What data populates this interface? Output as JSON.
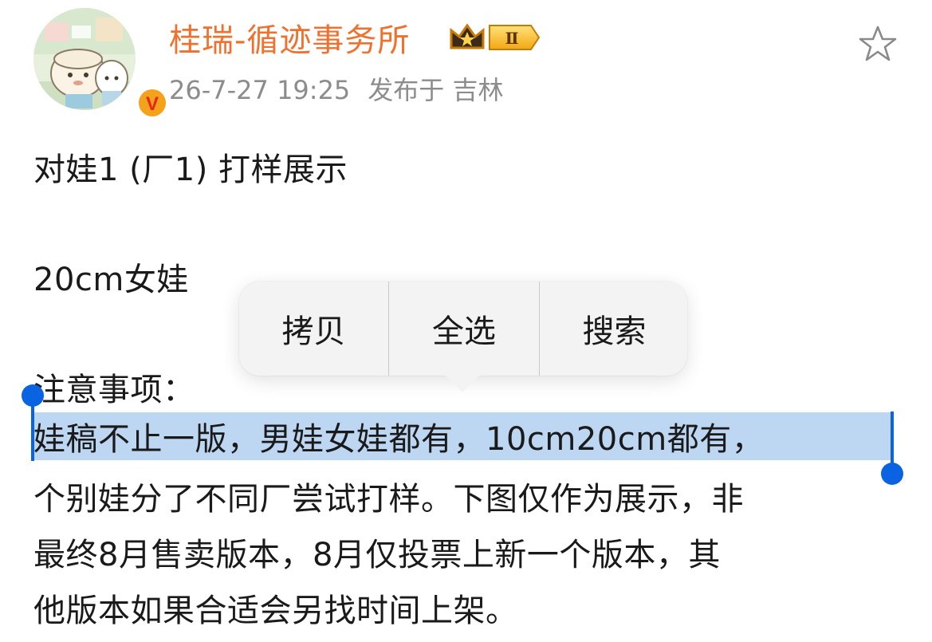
{
  "post": {
    "author": {
      "name": "桂瑞-循迹事务所",
      "vip_level": "Ⅱ",
      "verified_mark": "V"
    },
    "meta": {
      "time": "26-7-27 19:25",
      "location": "发布于 吉林"
    },
    "body": {
      "line1": "对娃1 (厂1) 打样展示",
      "line2": "20cm女娃",
      "line3": "注意事项：",
      "line4": "娃稿不止一版，男娃女娃都有，10cm20cm都有，",
      "line5": "个别娃分了不同厂尝试打样。下图仅作为展示，非",
      "line6": "最终8月售卖版本，8月仅投票上新一个版本，其",
      "line7": "他版本如果合适会另找时间上架。"
    }
  },
  "context_menu": {
    "items": [
      {
        "label": "拷贝"
      },
      {
        "label": "全选"
      },
      {
        "label": "搜索"
      }
    ]
  },
  "colors": {
    "username": "#f0712d",
    "meta": "#8c8c8c",
    "selection_highlight": "#bdd6f2",
    "selection_handle": "#0a63e0",
    "menu_bg": "#f3f3f3"
  },
  "icons": {
    "favorite": "star-outline-icon",
    "verified": "verified-badge-icon",
    "vip": "crown-vip-badge-icon"
  }
}
